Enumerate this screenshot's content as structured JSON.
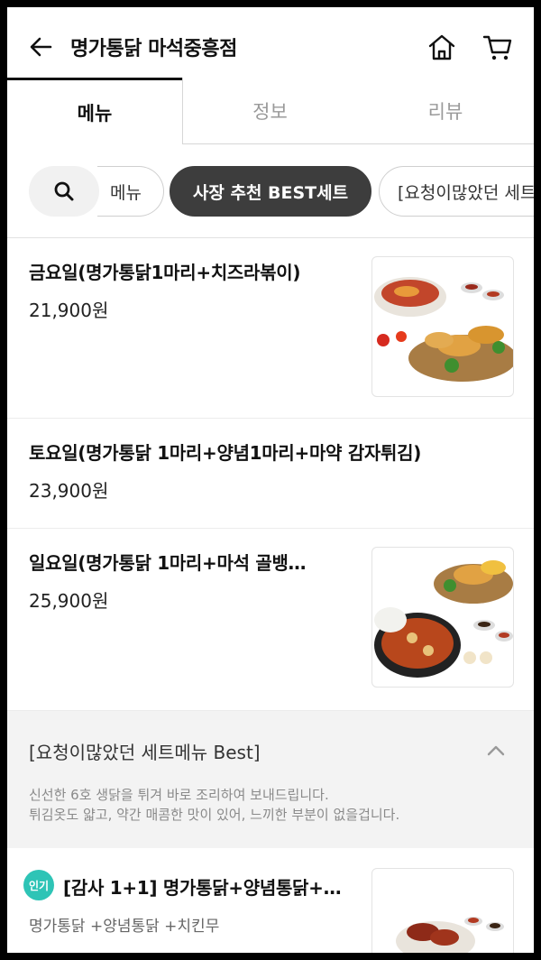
{
  "header": {
    "title": "명가통닭 마석중흥점",
    "icons": [
      "back-arrow-icon",
      "home-icon",
      "cart-icon"
    ]
  },
  "tabs": [
    {
      "label": "메뉴",
      "active": true
    },
    {
      "label": "정보",
      "active": false
    },
    {
      "label": "리뷰",
      "active": false
    }
  ],
  "chips": [
    {
      "label": "메뉴",
      "active": false
    },
    {
      "label": "사장 추천 BEST세트",
      "active": true
    },
    {
      "label": "[요청이많았던 세트",
      "active": false
    }
  ],
  "items": [
    {
      "name": "금요일(명가통닭1마리+치즈라볶이)",
      "price": "21,900원"
    },
    {
      "name": "토요일(명가통닭 1마리+양념1마리+마약 감자튀김)",
      "price": "23,900원"
    },
    {
      "name": "일요일(명가통닭 1마리+마석 골뱅…",
      "price": "25,900원"
    }
  ],
  "section": {
    "title": "[요청이많았던 세트메뉴 Best]",
    "desc_line1": "신선한 6호 생닭을 튀겨 바로 조리하여 보내드립니다.",
    "desc_line2": "튀김옷도 얇고, 약간 매콤한 맛이 있어, 느끼한 부분이 없을겁니다."
  },
  "featured": {
    "badge": "인기",
    "name": "[감사 1+1] 명가통닭+양념통닭+…",
    "desc": "명가통닭 +양념통닭 +치킨무"
  },
  "colors": {
    "accent": "#2ec4b6",
    "active_chip": "#3d3d3d"
  }
}
